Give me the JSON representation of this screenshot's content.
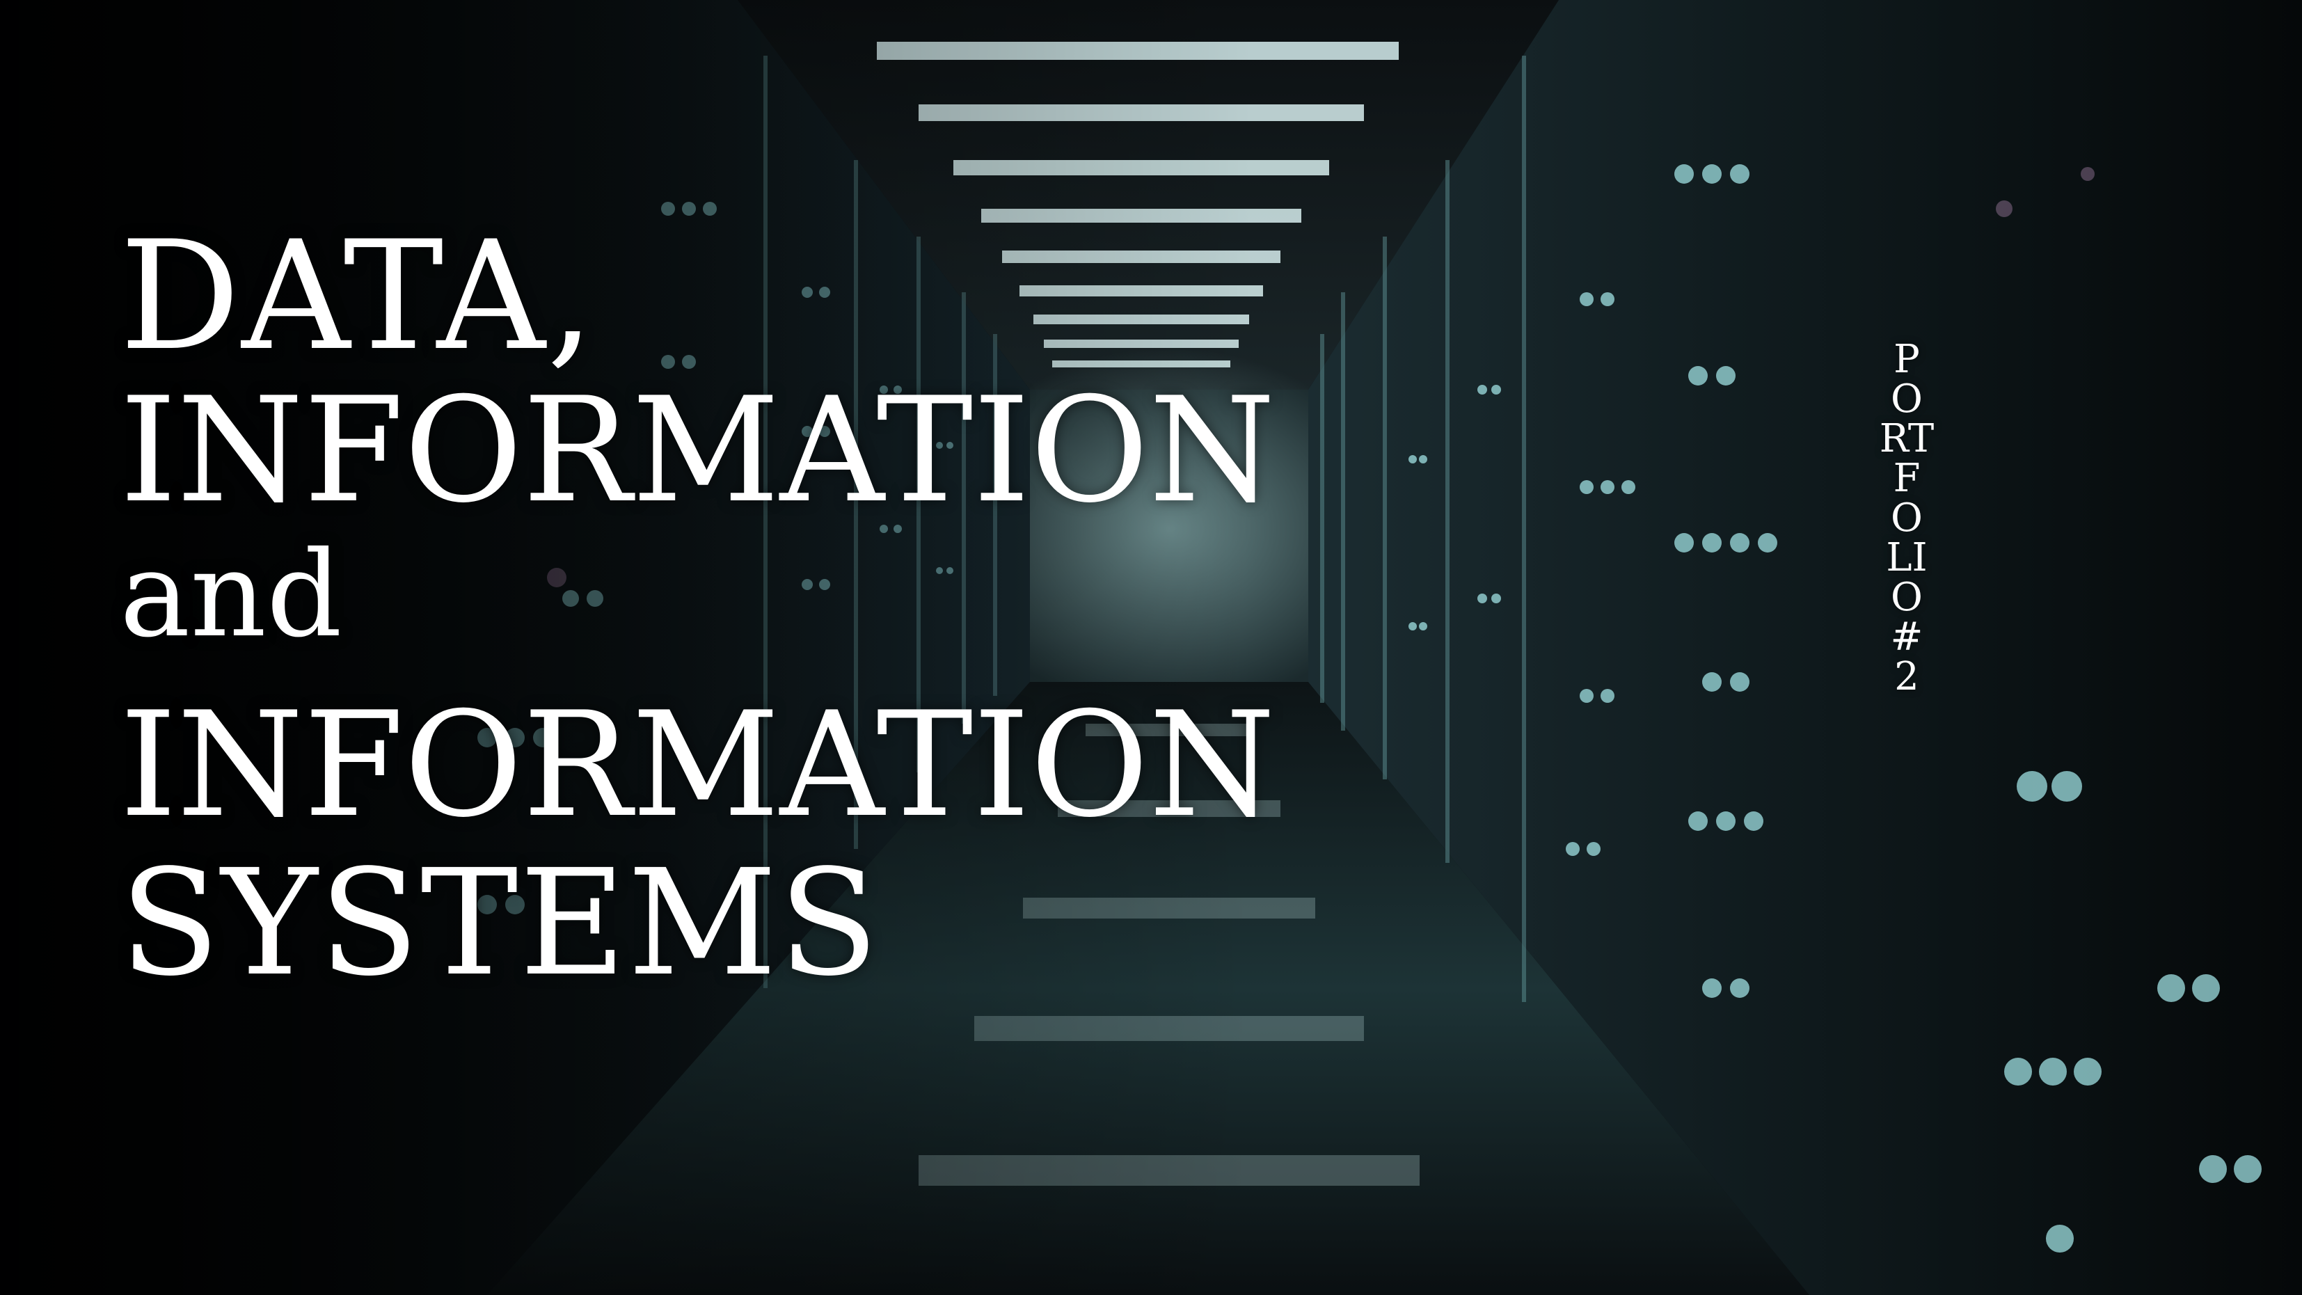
{
  "slide": {
    "title": {
      "line1": "DATA,",
      "line2": "INFORMATION",
      "line3": "and",
      "line4": "INFORMATION",
      "line5": "SYSTEMS"
    },
    "side_label": "PORTFOLIO#2"
  },
  "colors": {
    "text": "#ffffff",
    "background": "#07090b",
    "accent_teal": "#7fc4c8"
  },
  "background_image": {
    "subject": "server-room-corridor"
  }
}
